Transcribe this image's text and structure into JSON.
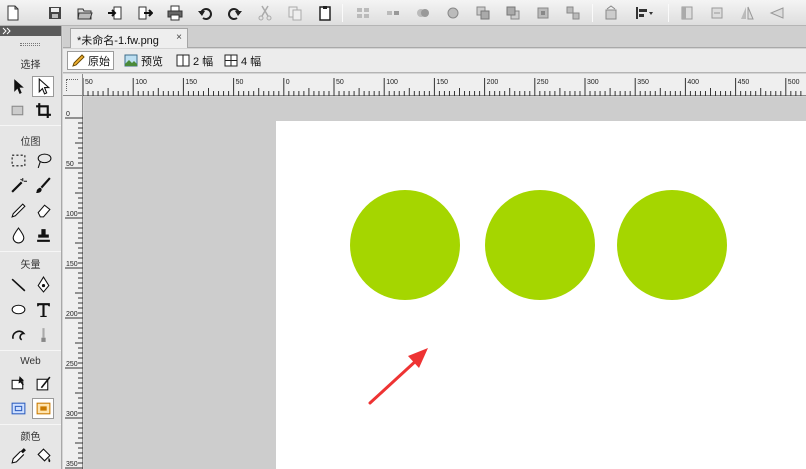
{
  "document": {
    "tab_title": "*未命名-1.fw.png",
    "close_glyph": "×"
  },
  "toolbar": {
    "icons": [
      "new-document-icon",
      "save-icon",
      "open-folder-icon",
      "import-icon",
      "export-icon",
      "print-icon",
      "undo-icon",
      "redo-icon",
      "cut-icon",
      "copy-icon",
      "paste-icon",
      "group-icon",
      "ungroup-icon",
      "join-icon",
      "split-icon",
      "bring-forward-icon",
      "send-backward-icon",
      "align-icon",
      "rotate-icon",
      "align-dropdown-icon",
      "flip-left-icon",
      "flip-right-icon",
      "flip-horizontal-icon",
      "flip-vertical-icon"
    ]
  },
  "view_modes": {
    "original": "原始",
    "preview": "预览",
    "two_up": "2 幅",
    "four_up": "4 幅"
  },
  "tools_panel": {
    "sections": {
      "select": "选择",
      "bitmap": "位图",
      "vector": "矢量",
      "web": "Web",
      "colors": "颜色"
    }
  },
  "rulers": {
    "horizontal_labels": [
      "50",
      "100",
      "150",
      "50",
      "0",
      "50",
      "100",
      "150",
      "200",
      "250",
      "300",
      "350",
      "400",
      "450",
      "500"
    ],
    "vertical_labels": [
      "0",
      "50",
      "100",
      "150",
      "200",
      "250",
      "300",
      "350"
    ]
  },
  "canvas": {
    "background": "#ffffff",
    "pasteboard": "#cdcdcd",
    "shape_color": "#a5d600",
    "arrow_color": "#ee3333",
    "shapes": [
      "circle",
      "circle",
      "circle"
    ]
  }
}
